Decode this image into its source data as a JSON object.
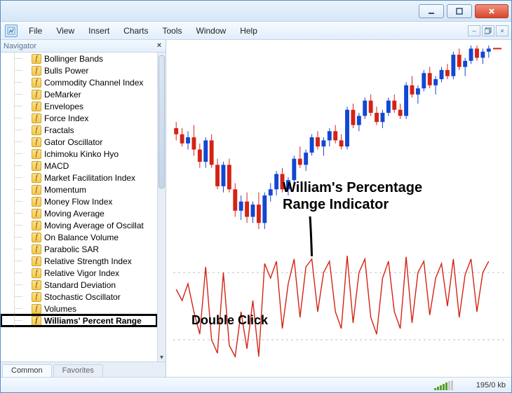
{
  "menu": {
    "file": "File",
    "view": "View",
    "insert": "Insert",
    "charts": "Charts",
    "tools": "Tools",
    "window": "Window",
    "help": "Help"
  },
  "navigator": {
    "title": "Navigator",
    "tabs": {
      "common": "Common",
      "favorites": "Favorites"
    },
    "items": [
      "Bollinger Bands",
      "Bulls Power",
      "Commodity Channel Index",
      "DeMarker",
      "Envelopes",
      "Force Index",
      "Fractals",
      "Gator Oscillator",
      "Ichimoku Kinko Hyo",
      "MACD",
      "Market Facilitation Index",
      "Momentum",
      "Money Flow Index",
      "Moving Average",
      "Moving Average of Oscillat",
      "On Balance Volume",
      "Parabolic SAR",
      "Relative Strength Index",
      "Relative Vigor Index",
      "Standard Deviation",
      "Stochastic Oscillator",
      "Volumes",
      "Williams' Percent Range"
    ],
    "highlight_index": 22
  },
  "chart_annotations": {
    "title_l1": "William's Percentage",
    "title_l2": "Range Indicator",
    "hint": "Double Click"
  },
  "statusbar": {
    "text": "195/0 kb"
  },
  "chart_data": {
    "type": "candlestick",
    "title": "",
    "xlabel": "",
    "ylabel": "",
    "x_range": [
      0,
      54
    ],
    "price_range": [
      1.3,
      1.36
    ],
    "candles_note": "approximate OHLC read from pixels; 54 bars",
    "candles": [
      {
        "o": 1.333,
        "h": 1.335,
        "l": 1.329,
        "c": 1.331
      },
      {
        "o": 1.331,
        "h": 1.333,
        "l": 1.327,
        "c": 1.328
      },
      {
        "o": 1.328,
        "h": 1.332,
        "l": 1.326,
        "c": 1.33
      },
      {
        "o": 1.33,
        "h": 1.334,
        "l": 1.324,
        "c": 1.326
      },
      {
        "o": 1.326,
        "h": 1.328,
        "l": 1.32,
        "c": 1.322
      },
      {
        "o": 1.322,
        "h": 1.33,
        "l": 1.32,
        "c": 1.329
      },
      {
        "o": 1.329,
        "h": 1.331,
        "l": 1.32,
        "c": 1.321
      },
      {
        "o": 1.321,
        "h": 1.323,
        "l": 1.313,
        "c": 1.314
      },
      {
        "o": 1.314,
        "h": 1.322,
        "l": 1.312,
        "c": 1.321
      },
      {
        "o": 1.321,
        "h": 1.323,
        "l": 1.312,
        "c": 1.313
      },
      {
        "o": 1.313,
        "h": 1.315,
        "l": 1.304,
        "c": 1.306
      },
      {
        "o": 1.306,
        "h": 1.311,
        "l": 1.303,
        "c": 1.309
      },
      {
        "o": 1.309,
        "h": 1.312,
        "l": 1.302,
        "c": 1.304
      },
      {
        "o": 1.304,
        "h": 1.309,
        "l": 1.302,
        "c": 1.308
      },
      {
        "o": 1.308,
        "h": 1.312,
        "l": 1.3,
        "c": 1.302
      },
      {
        "o": 1.302,
        "h": 1.312,
        "l": 1.3,
        "c": 1.311
      },
      {
        "o": 1.311,
        "h": 1.315,
        "l": 1.309,
        "c": 1.313
      },
      {
        "o": 1.313,
        "h": 1.319,
        "l": 1.311,
        "c": 1.318
      },
      {
        "o": 1.318,
        "h": 1.32,
        "l": 1.312,
        "c": 1.313
      },
      {
        "o": 1.313,
        "h": 1.317,
        "l": 1.311,
        "c": 1.316
      },
      {
        "o": 1.316,
        "h": 1.324,
        "l": 1.315,
        "c": 1.323
      },
      {
        "o": 1.323,
        "h": 1.327,
        "l": 1.32,
        "c": 1.321
      },
      {
        "o": 1.321,
        "h": 1.326,
        "l": 1.319,
        "c": 1.325
      },
      {
        "o": 1.325,
        "h": 1.331,
        "l": 1.324,
        "c": 1.33
      },
      {
        "o": 1.33,
        "h": 1.332,
        "l": 1.326,
        "c": 1.327
      },
      {
        "o": 1.327,
        "h": 1.33,
        "l": 1.324,
        "c": 1.329
      },
      {
        "o": 1.329,
        "h": 1.333,
        "l": 1.327,
        "c": 1.332
      },
      {
        "o": 1.332,
        "h": 1.334,
        "l": 1.328,
        "c": 1.329
      },
      {
        "o": 1.329,
        "h": 1.331,
        "l": 1.326,
        "c": 1.327
      },
      {
        "o": 1.327,
        "h": 1.34,
        "l": 1.326,
        "c": 1.339
      },
      {
        "o": 1.339,
        "h": 1.341,
        "l": 1.333,
        "c": 1.334
      },
      {
        "o": 1.334,
        "h": 1.338,
        "l": 1.332,
        "c": 1.337
      },
      {
        "o": 1.337,
        "h": 1.343,
        "l": 1.336,
        "c": 1.342
      },
      {
        "o": 1.342,
        "h": 1.344,
        "l": 1.337,
        "c": 1.338
      },
      {
        "o": 1.338,
        "h": 1.34,
        "l": 1.334,
        "c": 1.335
      },
      {
        "o": 1.335,
        "h": 1.339,
        "l": 1.333,
        "c": 1.338
      },
      {
        "o": 1.338,
        "h": 1.343,
        "l": 1.337,
        "c": 1.342
      },
      {
        "o": 1.342,
        "h": 1.344,
        "l": 1.338,
        "c": 1.339
      },
      {
        "o": 1.339,
        "h": 1.341,
        "l": 1.336,
        "c": 1.337
      },
      {
        "o": 1.337,
        "h": 1.348,
        "l": 1.336,
        "c": 1.347
      },
      {
        "o": 1.347,
        "h": 1.35,
        "l": 1.343,
        "c": 1.344
      },
      {
        "o": 1.344,
        "h": 1.347,
        "l": 1.341,
        "c": 1.346
      },
      {
        "o": 1.346,
        "h": 1.352,
        "l": 1.345,
        "c": 1.351
      },
      {
        "o": 1.351,
        "h": 1.353,
        "l": 1.346,
        "c": 1.347
      },
      {
        "o": 1.347,
        "h": 1.35,
        "l": 1.344,
        "c": 1.349
      },
      {
        "o": 1.349,
        "h": 1.353,
        "l": 1.348,
        "c": 1.352
      },
      {
        "o": 1.352,
        "h": 1.354,
        "l": 1.349,
        "c": 1.35
      },
      {
        "o": 1.35,
        "h": 1.358,
        "l": 1.349,
        "c": 1.357
      },
      {
        "o": 1.357,
        "h": 1.359,
        "l": 1.352,
        "c": 1.353
      },
      {
        "o": 1.353,
        "h": 1.356,
        "l": 1.35,
        "c": 1.355
      },
      {
        "o": 1.355,
        "h": 1.36,
        "l": 1.354,
        "c": 1.359
      },
      {
        "o": 1.359,
        "h": 1.36,
        "l": 1.355,
        "c": 1.356
      },
      {
        "o": 1.356,
        "h": 1.359,
        "l": 1.354,
        "c": 1.358
      },
      {
        "o": 1.358,
        "h": 1.36,
        "l": 1.356,
        "c": 1.359
      }
    ],
    "indicator": {
      "name": "Williams' Percent Range",
      "range": [
        -100,
        0
      ],
      "levels": [
        -20,
        -80
      ],
      "values_note": "approximate %R per bar read from sub-panel",
      "values": [
        -35,
        -45,
        -30,
        -55,
        -75,
        -15,
        -80,
        -92,
        -20,
        -85,
        -95,
        -55,
        -88,
        -45,
        -95,
        -12,
        -25,
        -10,
        -70,
        -30,
        -8,
        -60,
        -15,
        -8,
        -55,
        -20,
        -10,
        -55,
        -70,
        -5,
        -65,
        -20,
        -8,
        -60,
        -75,
        -25,
        -10,
        -55,
        -70,
        -6,
        -65,
        -20,
        -10,
        -58,
        -25,
        -12,
        -50,
        -8,
        -60,
        -22,
        -8,
        -55,
        -20,
        -10
      ]
    }
  }
}
